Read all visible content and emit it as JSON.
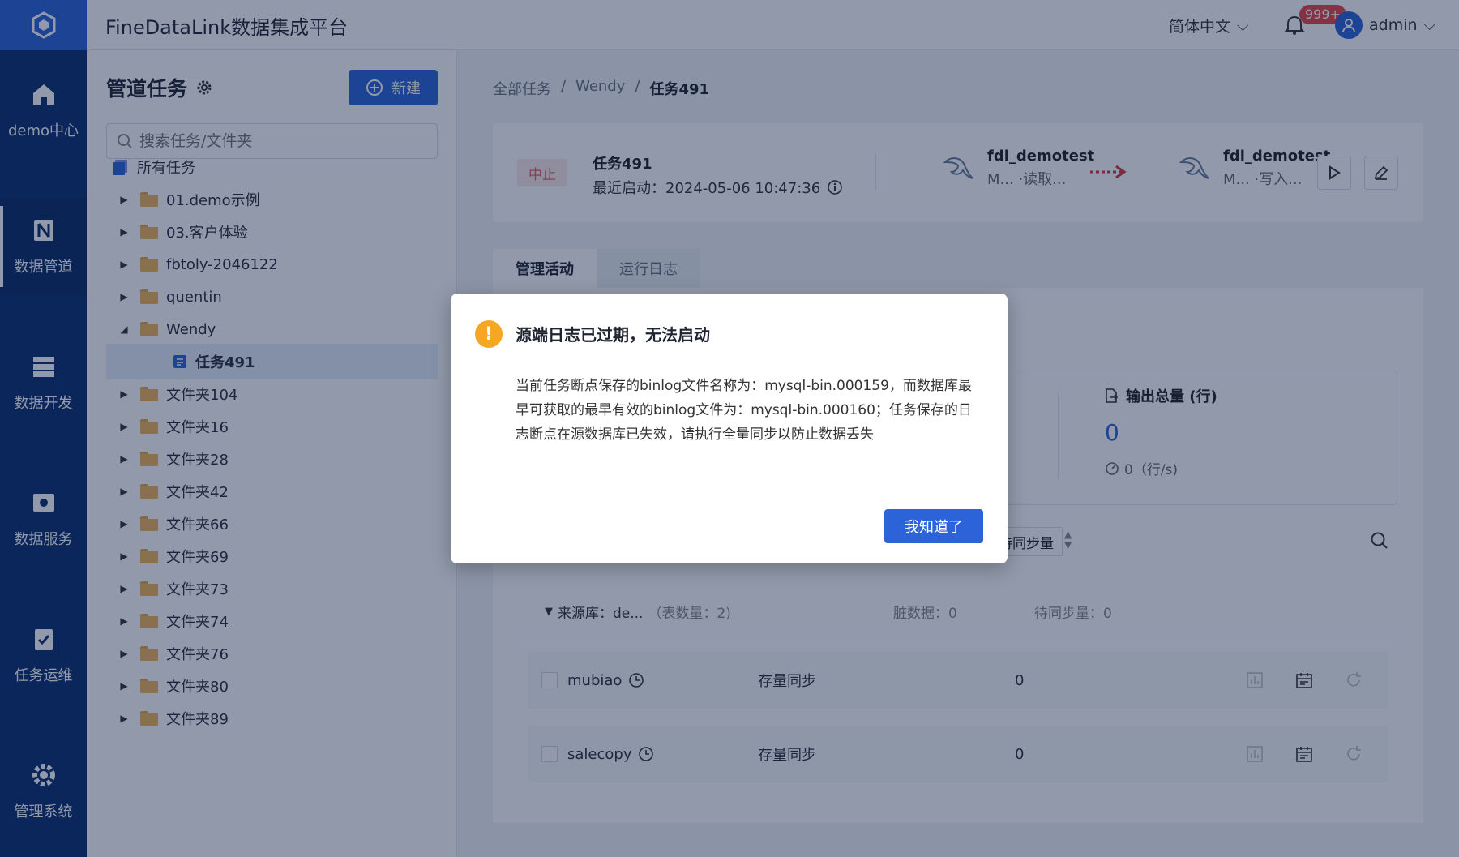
{
  "app": {
    "title": "FineDataLink数据集成平台"
  },
  "topbar": {
    "language": "简体中文",
    "notification_count": "999+",
    "user": "admin"
  },
  "rail": {
    "items": [
      {
        "label": "demo中心",
        "icon": "home-icon"
      },
      {
        "label": "数据管道",
        "icon": "pipeline-icon",
        "active": true
      },
      {
        "label": "数据开发",
        "icon": "dev-icon"
      },
      {
        "label": "数据服务",
        "icon": "service-icon"
      },
      {
        "label": "任务运维",
        "icon": "ops-icon"
      },
      {
        "label": "管理系统",
        "icon": "gear-icon"
      }
    ]
  },
  "tree": {
    "title": "管道任务",
    "new_button": "新建",
    "search_placeholder": "搜索任务/文件夹",
    "root": "所有任务",
    "items": [
      {
        "label": "01.demo示例"
      },
      {
        "label": "03.客户体验"
      },
      {
        "label": "fbtoly-2046122"
      },
      {
        "label": "quentin"
      },
      {
        "label": "Wendy"
      },
      {
        "label": "任务491"
      },
      {
        "label": "文件夹104"
      },
      {
        "label": "文件夹16"
      },
      {
        "label": "文件夹28"
      },
      {
        "label": "文件夹42"
      },
      {
        "label": "文件夹66"
      },
      {
        "label": "文件夹69"
      },
      {
        "label": "文件夹73"
      },
      {
        "label": "文件夹74"
      },
      {
        "label": "文件夹76"
      },
      {
        "label": "文件夹80"
      },
      {
        "label": "文件夹89"
      }
    ]
  },
  "breadcrumb": [
    "全部任务",
    "/",
    "Wendy",
    "/",
    "任务491"
  ],
  "summary": {
    "status": "中止",
    "task_name": "任务491",
    "last_start": "最近启动：2024-05-06 10:47:36",
    "source": {
      "name": "fdl_demotest",
      "sub": "M... ·读取..."
    },
    "target": {
      "name": "fdl_demotest",
      "sub": "M... ·写入..."
    }
  },
  "tabs": [
    "管理活动",
    "运行日志"
  ],
  "stats": {
    "output_label": "输出总量 (行)",
    "output_value": "0",
    "output_rate": "0（行/s)"
  },
  "filter": {
    "label": "待同步量"
  },
  "source_group": {
    "label": "来源库：de...",
    "count": "（表数量：2)",
    "dirty": "脏数据：0",
    "pending": "待同步量：0"
  },
  "rows": [
    {
      "name": "mubiao",
      "mode": "存量同步",
      "value": "0"
    },
    {
      "name": "salecopy",
      "mode": "存量同步",
      "value": "0"
    }
  ],
  "modal": {
    "title": "源端日志已过期，无法启动",
    "body": "当前任务断点保存的binlog文件名称为：mysql-bin.000159，而数据库最早可获取的最早有效的binlog文件为：mysql-bin.000160；任务保存的日志断点在源数据库已失效，请执行全量同步以防止数据丢失",
    "ok": "我知道了"
  },
  "colors": {
    "brand": "#2c63d8",
    "rail": "#0c2f6e",
    "warning": "#f6a623"
  }
}
